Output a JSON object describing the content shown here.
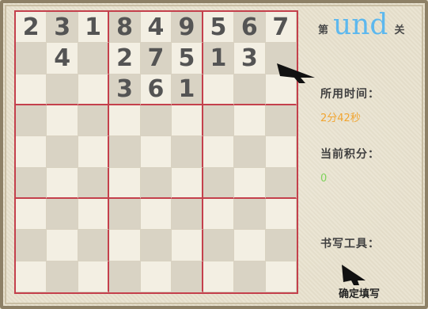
{
  "level": {
    "prefix": "第",
    "value": "und",
    "suffix": "关"
  },
  "time": {
    "label": "所用时间：",
    "value": "2分42秒"
  },
  "score": {
    "label": "当前积分：",
    "value": "0"
  },
  "tools": {
    "label": "书写工具：",
    "confirm_label": "确定填写"
  },
  "colors": {
    "box_border": "#c4404c",
    "digit": "#545454",
    "level_number": "#5db8ee",
    "time_value": "#f1a531",
    "score_value": "#7fd35a"
  },
  "icons": [
    "arrow-cursor-icon",
    "arrow-cursor-icon"
  ],
  "board": [
    [
      "2",
      "3",
      "1",
      "8",
      "4",
      "9",
      "5",
      "6",
      "7"
    ],
    [
      "",
      "4",
      "",
      "2",
      "7",
      "5",
      "1",
      "3",
      ""
    ],
    [
      "",
      "",
      "",
      "3",
      "6",
      "1",
      "",
      "",
      ""
    ],
    [
      "",
      "",
      "",
      "",
      "",
      "",
      "",
      "",
      ""
    ],
    [
      "",
      "",
      "",
      "",
      "",
      "",
      "",
      "",
      ""
    ],
    [
      "",
      "",
      "",
      "",
      "",
      "",
      "",
      "",
      ""
    ],
    [
      "",
      "",
      "",
      "",
      "",
      "",
      "",
      "",
      ""
    ],
    [
      "",
      "",
      "",
      "",
      "",
      "",
      "",
      "",
      ""
    ],
    [
      "",
      "",
      "",
      "",
      "",
      "",
      "",
      "",
      ""
    ]
  ]
}
